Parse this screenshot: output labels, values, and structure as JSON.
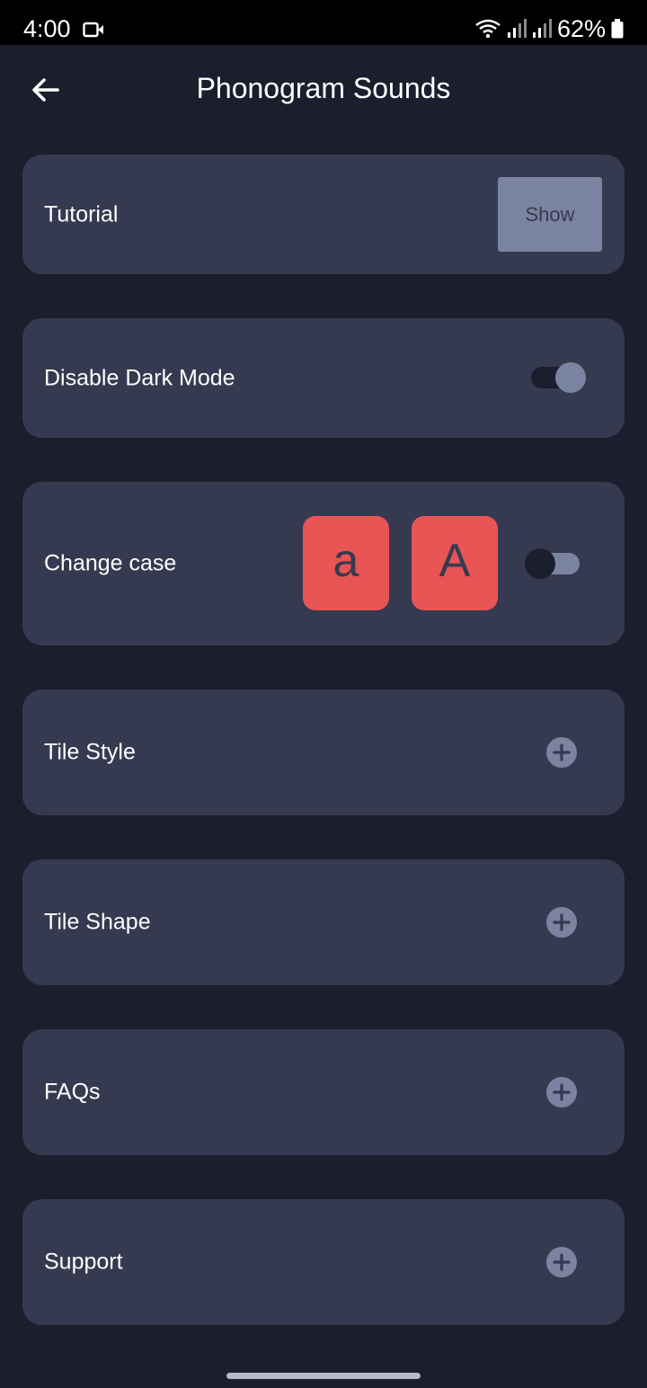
{
  "status_bar": {
    "time": "4:00",
    "battery": "62%",
    "icons": [
      "video-camera-icon",
      "wifi-icon",
      "signal-icon",
      "signal-icon",
      "battery-icon"
    ]
  },
  "app_bar": {
    "title": "Phonogram Sounds",
    "back_icon": "arrow-left-icon"
  },
  "settings": {
    "tutorial": {
      "label": "Tutorial",
      "button_label": "Show"
    },
    "dark_mode": {
      "label": "Disable Dark Mode",
      "toggle_on": true
    },
    "change_case": {
      "label": "Change case",
      "lower_tile": "a",
      "upper_tile": "A",
      "toggle_on": false
    },
    "tile_style": {
      "label": "Tile Style",
      "icon": "plus-circle-icon"
    },
    "tile_shape": {
      "label": "Tile Shape",
      "icon": "plus-circle-icon"
    },
    "faqs": {
      "label": "FAQs",
      "icon": "plus-circle-icon"
    },
    "support": {
      "label": "Support",
      "icon": "plus-circle-icon"
    }
  },
  "colors": {
    "background": "#1b1e2c",
    "card": "#363a50",
    "accent_tile": "#e85555",
    "muted": "#7a839f",
    "text": "#ffffff"
  }
}
